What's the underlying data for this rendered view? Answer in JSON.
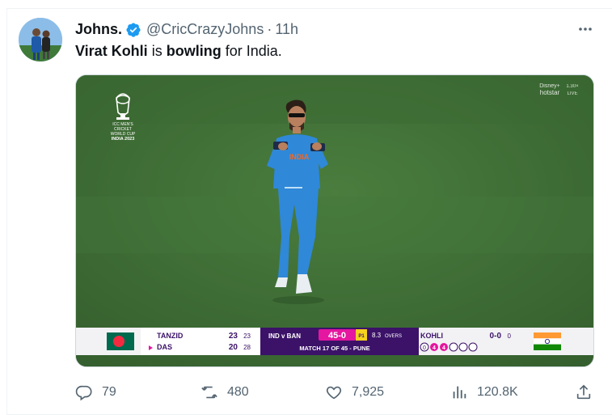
{
  "tweet": {
    "author_name": "Johns.",
    "handle": "@CricCrazyJohns",
    "separator": "·",
    "time": "11h",
    "text": {
      "part1": "Virat Kohli",
      "part2": " is ",
      "part3": "bowling",
      "part4": " for India."
    }
  },
  "media": {
    "logo_lines": [
      "ICC MEN'S",
      "CRICKET",
      "WORLD CUP",
      "INDIA 2023"
    ],
    "broadcaster": "Disney+",
    "broadcaster_sub": "hotstar",
    "live_badge": "1.30×",
    "live_label": "LIVE",
    "jersey_text": "INDIA",
    "scorebar": {
      "batter1_name": "TANZID",
      "batter1_runs": "23",
      "batter1_balls": "23",
      "batter2_name": "DAS",
      "batter2_runs": "20",
      "batter2_balls": "28",
      "teams": "IND v BAN",
      "score": "45-0",
      "pp": "P1",
      "overs_value": "8.3",
      "overs_label": "OVERS",
      "match_info": "MATCH 17 OF 45 - PUNE",
      "bowler_name": "KOHLI",
      "bowler_figures": "0-0",
      "bowler_overs": "0",
      "balls": [
        "0",
        "4",
        "4",
        "",
        "",
        ""
      ]
    },
    "colors": {
      "pitch_green": "#3d6e34",
      "scorebar_purple": "#3b1268",
      "score_pink": "#e5169f",
      "bangladesh_green": "#006a4e",
      "bangladesh_red": "#f42a41",
      "india_saffron": "#ff9933",
      "india_green": "#138808"
    }
  },
  "actions": {
    "replies": "79",
    "retweets": "480",
    "likes": "7,925",
    "views": "120.8K"
  },
  "icons": {
    "verified": "verified-badge-icon",
    "more": "more-icon",
    "reply": "reply-icon",
    "retweet": "retweet-icon",
    "like": "like-icon",
    "views": "views-icon",
    "share": "share-icon"
  }
}
